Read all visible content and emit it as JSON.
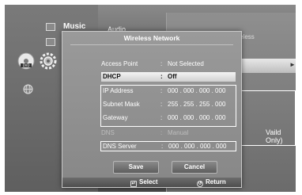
{
  "home_menu": {
    "music_label": "Music",
    "audio_label": "Audio"
  },
  "background_menu": {
    "network_selection_text": "Network Selection : Wireless",
    "note_text": "Vaild Only)"
  },
  "dialog": {
    "title": "Wireless Network",
    "rows": [
      {
        "label": "Access Point",
        "separator": ":",
        "value": "Not Selected"
      },
      {
        "label": "DHCP",
        "separator": ":",
        "value": "Off"
      },
      {
        "label": "IP Address",
        "separator": ":",
        "value": "000 . 000 . 000 . 000"
      },
      {
        "label": "Subnet Mask",
        "separator": ":",
        "value": "255 . 255 . 255 . 000"
      },
      {
        "label": "Gateway",
        "separator": ":",
        "value": "000 . 000 . 000 . 000"
      },
      {
        "label": "DNS",
        "separator": ":",
        "value": "Manual"
      },
      {
        "label": "DNS Server",
        "separator": ":",
        "value": "000 . 000 . 000 . 000"
      }
    ],
    "save_label": "Save",
    "cancel_label": "Cancel"
  },
  "footer": {
    "select_label": "Select",
    "return_label": "Return",
    "select_icon": "enter-icon",
    "return_icon": "return-icon"
  },
  "colors": {
    "accent": "#ffffff",
    "selected_row": "#e6e6e6"
  }
}
